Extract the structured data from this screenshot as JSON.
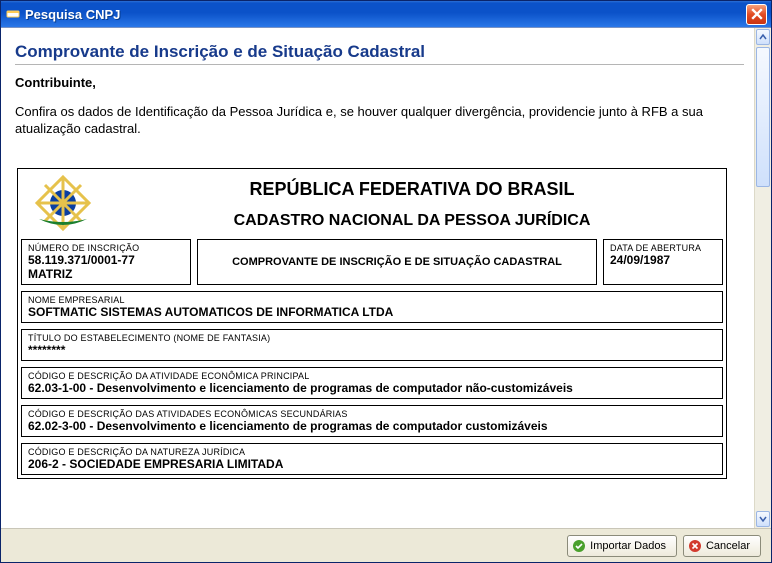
{
  "window": {
    "title": "Pesquisa CNPJ"
  },
  "page": {
    "heading": "Comprovante de Inscrição e de Situação Cadastral",
    "salutation": "Contribuinte,",
    "intro": "Confira os dados de Identificação da Pessoa Jurídica e, se houver qualquer divergência, providencie junto à RFB a sua atualização cadastral."
  },
  "document": {
    "country": "REPÚBLICA FEDERATIVA DO BRASIL",
    "registry": "CADASTRO NACIONAL DA PESSOA JURÍDICA",
    "numInscricaoLabel": "NÚMERO DE INSCRIÇÃO",
    "numInscricao": "58.119.371/0001-77",
    "numInscricaoTipo": "MATRIZ",
    "docTitle": "COMPROVANTE DE INSCRIÇÃO E DE SITUAÇÃO CADASTRAL",
    "dataAberturaLabel": "DATA DE ABERTURA",
    "dataAbertura": "24/09/1987",
    "nomeEmpresarialLabel": "NOME EMPRESARIAL",
    "nomeEmpresarial": "SOFTMATIC SISTEMAS AUTOMATICOS DE INFORMATICA LTDA",
    "tituloEstabelecimentoLabel": "TÍTULO DO ESTABELECIMENTO (NOME DE FANTASIA)",
    "tituloEstabelecimento": "********",
    "cnaePrincipalLabel": "CÓDIGO E DESCRIÇÃO DA ATIVIDADE ECONÔMICA PRINCIPAL",
    "cnaePrincipal": "62.03-1-00 - Desenvolvimento e licenciamento de programas de computador não-customizáveis",
    "cnaeSecundariasLabel": "CÓDIGO E DESCRIÇÃO DAS ATIVIDADES ECONÔMICAS SECUNDÁRIAS",
    "cnaeSecundarias": "62.02-3-00 - Desenvolvimento e licenciamento de programas de computador customizáveis",
    "naturezaJuridicaLabel": "CÓDIGO E DESCRIÇÃO DA NATUREZA JURÍDICA",
    "naturezaJuridica": "206-2 - SOCIEDADE EMPRESARIA LIMITADA"
  },
  "buttons": {
    "import": "Importar Dados",
    "cancel": "Cancelar"
  }
}
